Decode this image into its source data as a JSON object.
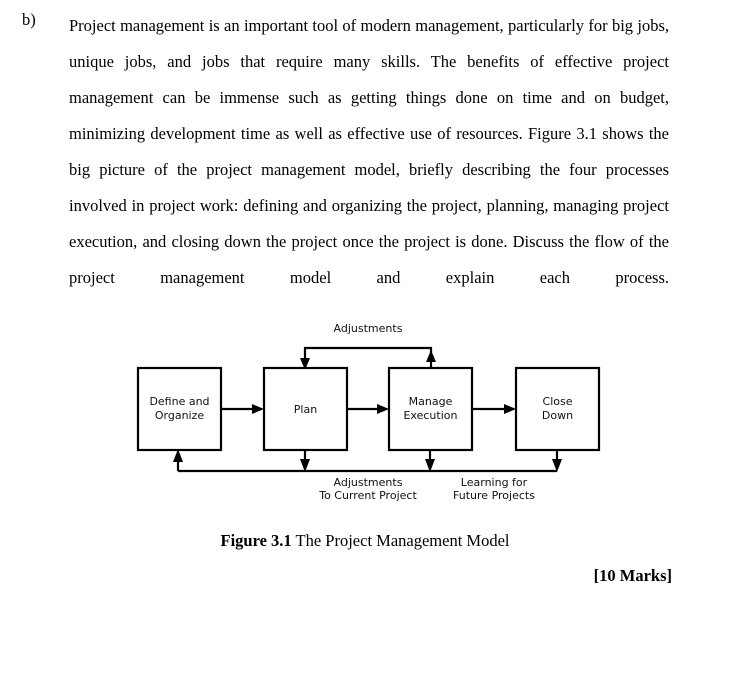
{
  "question": {
    "item_label": "b)",
    "body": "Project management is an important tool of modern management, particularly for big jobs, unique jobs, and jobs that require many skills. The benefits of effective project management can be immense such as getting things done on time and on budget, minimizing development time as well as effective use of resources. Figure 3.1 shows the big picture of the project management model, briefly describing the four processes involved in project work: defining and organizing the project, planning, managing project execution, and closing down the project once the project is done. Discuss the flow of the project management model and explain each process.",
    "marks": "[10 Marks]"
  },
  "figure": {
    "caption_number": "Figure 3.1",
    "caption_text": " The Project Management Model",
    "diagram": {
      "type": "flowchart",
      "boxes": [
        {
          "id": "define",
          "line1": "Define and",
          "line2": "Organize"
        },
        {
          "id": "plan",
          "line1": "Plan",
          "line2": ""
        },
        {
          "id": "manage",
          "line1": "Manage",
          "line2": "Execution"
        },
        {
          "id": "close",
          "line1": "Close",
          "line2": "Down"
        }
      ],
      "annotations": {
        "top_loop": "Adjustments",
        "bottom_mid_line1": "Adjustments",
        "bottom_mid_line2": "To Current Project",
        "bottom_right_line1": "Learning for",
        "bottom_right_line2": "Future Projects"
      },
      "flow_sequence": "Define and Organize → Plan → Manage Execution → Close Down",
      "feedback_loops": [
        "Manage Execution → Plan (Adjustments)",
        "Plan → Define and Organize (Adjustments To Current Project)",
        "Manage Execution → Define and Organize (Adjustments To Current Project)",
        "Close Down → Define and Organize (Learning for Future Projects)"
      ],
      "stroke_color": "#000000",
      "box_fill": "#ffffff"
    }
  }
}
